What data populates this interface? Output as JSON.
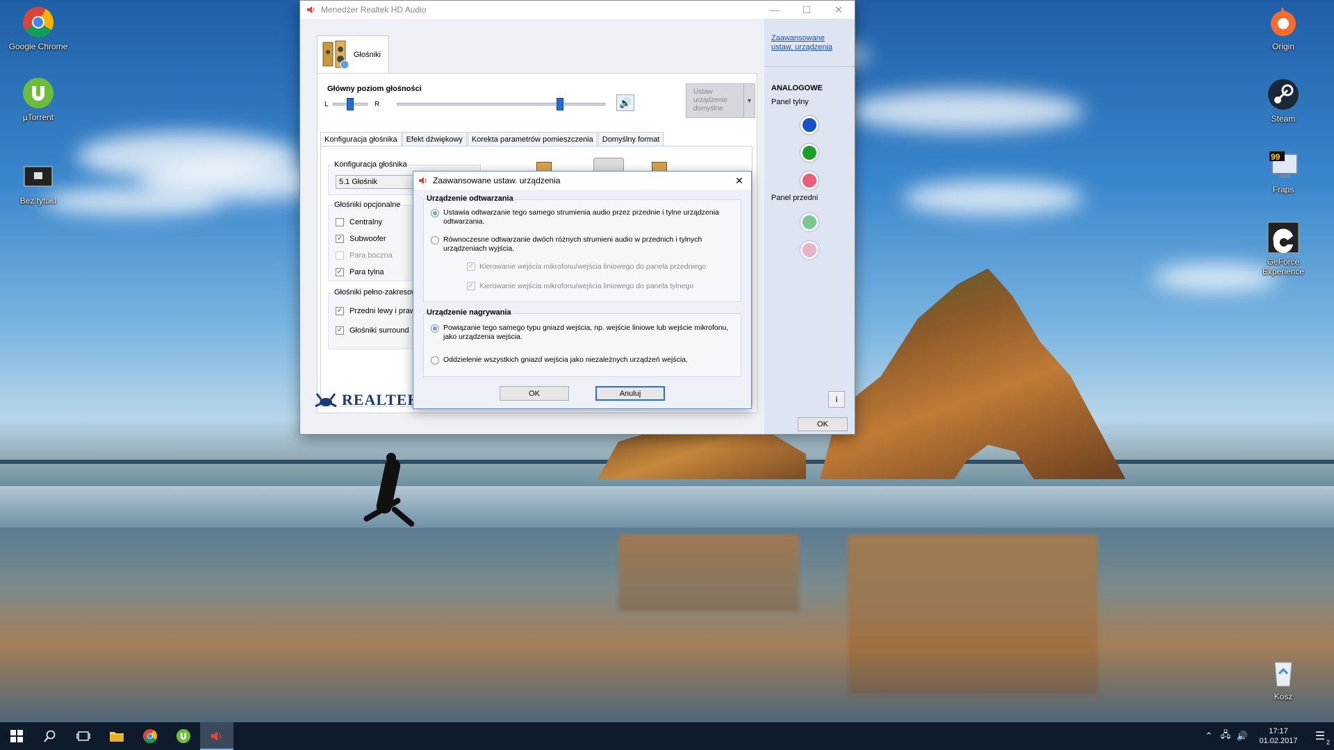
{
  "desktop": {
    "icons_left": [
      {
        "label": "Google Chrome",
        "icon": "chrome-icon"
      },
      {
        "label": "µTorrent",
        "icon": "utorrent-icon"
      },
      {
        "label": "Bez tytułu",
        "icon": "image-file-icon"
      }
    ],
    "icons_right": [
      {
        "label": "Origin",
        "icon": "origin-icon"
      },
      {
        "label": "Steam",
        "icon": "steam-icon"
      },
      {
        "label": "Fraps",
        "icon": "fraps-icon"
      },
      {
        "label": "GeForce Experience",
        "icon": "geforce-icon"
      },
      {
        "label": "Kosz",
        "icon": "recycle-bin-icon"
      }
    ]
  },
  "realtek": {
    "title": "Menedżer Realtek HD Audio",
    "device_tab": "Głośniki",
    "volume_label": "Główny poziom głośności",
    "balance_l": "L",
    "balance_r": "R",
    "set_default": "Ustaw urządzenie domyślne",
    "subtabs": [
      "Konfiguracja głośnika",
      "Efekt dźwiękowy",
      "Korekta parametrów pomieszczenia",
      "Domyślny format"
    ],
    "speaker_config_label": "Konfiguracja głośnika",
    "speaker_config_value": "5.1 Głośnik",
    "optional_label": "Głośniki opcjonalne",
    "optional": [
      {
        "label": "Centralny",
        "checked": false,
        "disabled": false
      },
      {
        "label": "Subwoofer",
        "checked": true,
        "disabled": false
      },
      {
        "label": "Para boczna",
        "checked": false,
        "disabled": true
      },
      {
        "label": "Para tylna",
        "checked": true,
        "disabled": false
      }
    ],
    "fullrange_label": "Głośniki pełno-zakresow",
    "fullrange": [
      {
        "label": "Przedni lewy i praw",
        "checked": true
      },
      {
        "label": "Głośniki surround",
        "checked": true
      }
    ],
    "side_link": "Zaawansowane ustaw. urządzenia",
    "analog_label": "ANALOGOWE",
    "rear_panel": "Panel tylny",
    "front_panel": "Panel przedni",
    "brand": "REALTEK",
    "ok": "OK",
    "info": "i",
    "jack_colors": {
      "rear": [
        "#1554c8",
        "#18a02a",
        "#e8607a"
      ],
      "front": [
        "#4fbf66",
        "#eaa0b0"
      ]
    }
  },
  "dialog": {
    "title": "Zaawansowane ustaw. urządzenia",
    "playback_label": "Urządzenie odtwarzania",
    "playback_opt1": "Ustawia odtwarzanie tego samego strumienia audio przez przednie i tylne urządzenia odtwarzania.",
    "playback_opt2": "Równoczesne odtwarzanie dwóch różnych strumieni audio w przednich i tylnych urządzeniach wyjścia.",
    "sub_front": "Kierowanie wejścia mikrofonu/wejścia liniowego do panela przedniego",
    "sub_rear": "Kierowanie wejścia mikrofonu/wejścia liniowego do panela tylnego",
    "record_label": "Urządzenie nagrywania",
    "record_opt1": "Powiązanie tego samego typu gniazd wejścia, np. wejście liniowe lub wejście mikrofonu, jako urządzenia wejścia.",
    "record_opt2": "Oddzielenie wszystkich gniazd wejścia jako niezależnych urządzeń wejścia.",
    "ok": "OK",
    "cancel": "Anuluj"
  },
  "taskbar": {
    "time": "17:17",
    "date": "01.02.2017",
    "notifications": "2"
  }
}
